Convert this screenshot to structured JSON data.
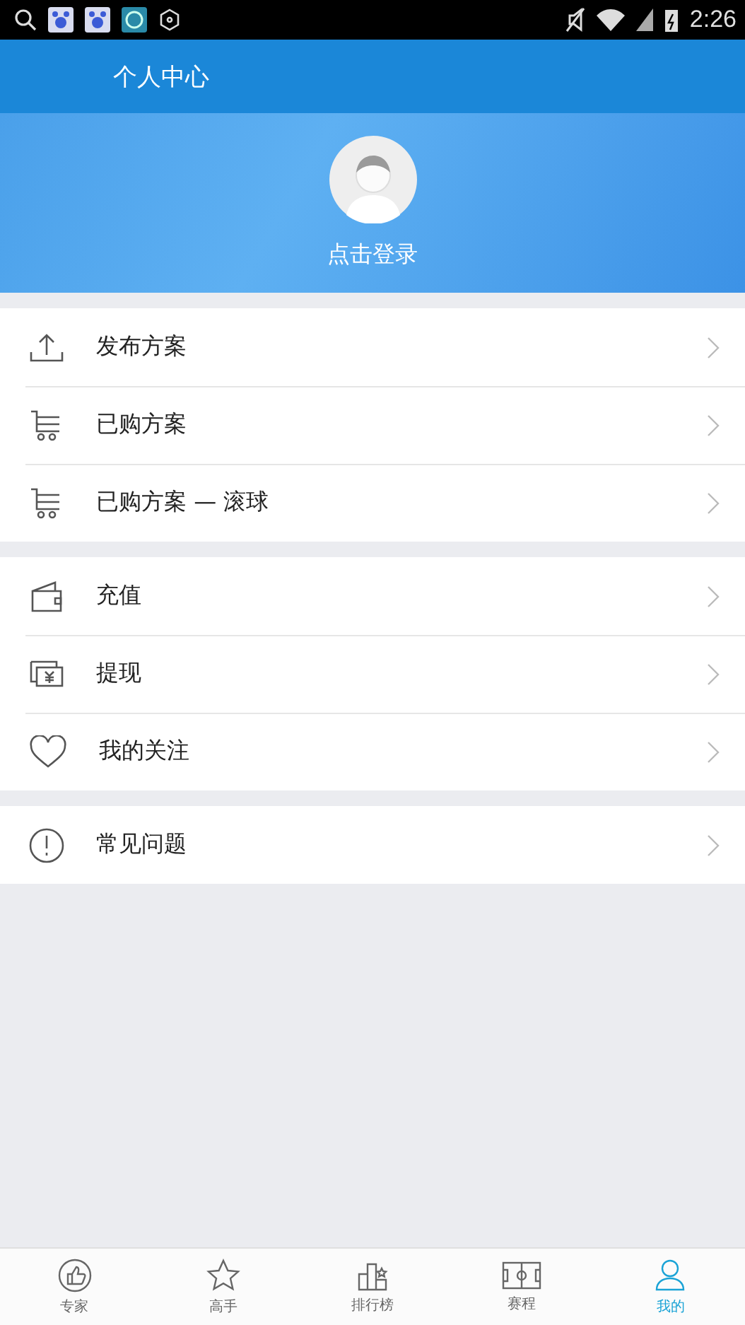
{
  "status_bar": {
    "time": "2:26"
  },
  "header": {
    "title": "个人中心"
  },
  "profile": {
    "login_label": "点击登录"
  },
  "menu_groups": [
    {
      "items": [
        {
          "kind": "upload",
          "label": "发布方案"
        },
        {
          "kind": "cart",
          "label": "已购方案"
        },
        {
          "kind": "cart",
          "label": "已购方案 — 滚球"
        }
      ]
    },
    {
      "items": [
        {
          "kind": "wallet",
          "label": "充值"
        },
        {
          "kind": "cash",
          "label": "提现"
        },
        {
          "kind": "heart",
          "label": "我的关注"
        }
      ]
    },
    {
      "items": [
        {
          "kind": "alert",
          "label": "常见问题"
        }
      ]
    }
  ],
  "bottom_nav": [
    {
      "kind": "thumb",
      "label": "专家",
      "selected": false
    },
    {
      "kind": "star",
      "label": "高手",
      "selected": false
    },
    {
      "kind": "ranking",
      "label": "排行榜",
      "selected": false
    },
    {
      "kind": "field",
      "label": "赛程",
      "selected": false
    },
    {
      "kind": "person",
      "label": "我的",
      "selected": true
    }
  ]
}
